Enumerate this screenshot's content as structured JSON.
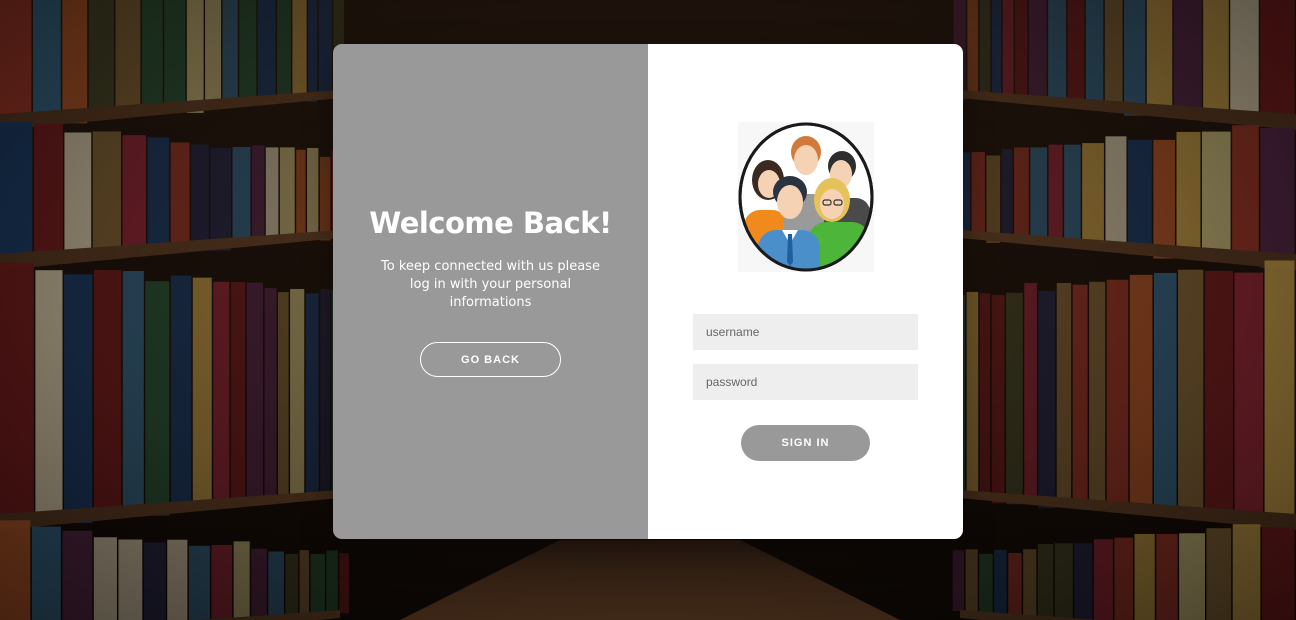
{
  "welcome": {
    "title": "Welcome Back!",
    "message": "To keep connected with us please log in with your personal informations",
    "go_back_label": "GO BACK"
  },
  "login": {
    "username_placeholder": "username",
    "password_placeholder": "password",
    "sign_in_label": "SIGN IN"
  },
  "icons": {
    "avatar": "user-group-icon"
  },
  "colors": {
    "left_panel": "#999999",
    "right_panel": "#ffffff",
    "input_bg": "#eeeeee",
    "button": "#999999"
  }
}
